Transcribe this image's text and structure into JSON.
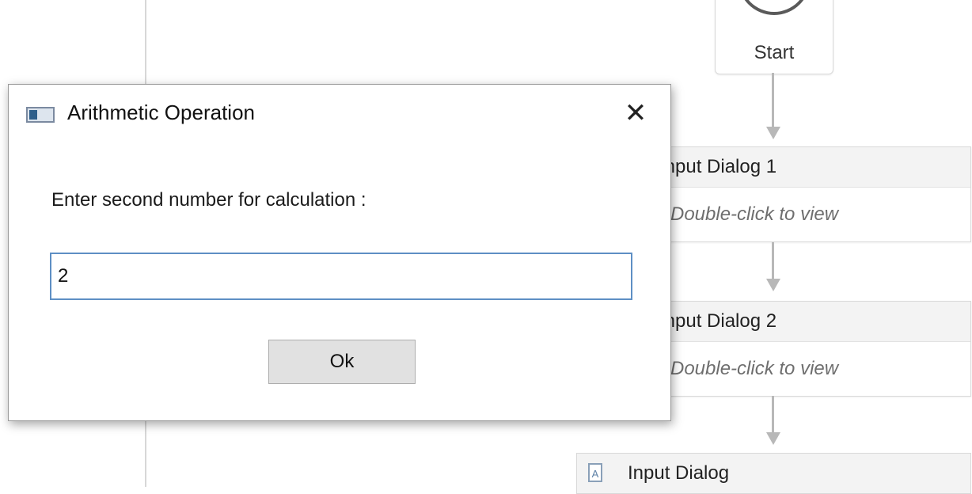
{
  "workflow": {
    "start_label": "Start",
    "activities": [
      {
        "title": "Input Dialog 1",
        "body": "Double-click to view"
      },
      {
        "title": "Input Dialog 2",
        "body": "Double-click to view"
      },
      {
        "title": "Input Dialog"
      }
    ]
  },
  "dialog": {
    "title": "Arithmetic Operation",
    "close_glyph": "✕",
    "prompt": "Enter second number for calculation :",
    "input_value": "2",
    "ok_label": "Ok"
  },
  "icons": {
    "app": "window-icon",
    "close": "close-icon",
    "activity": "text-document-icon"
  }
}
